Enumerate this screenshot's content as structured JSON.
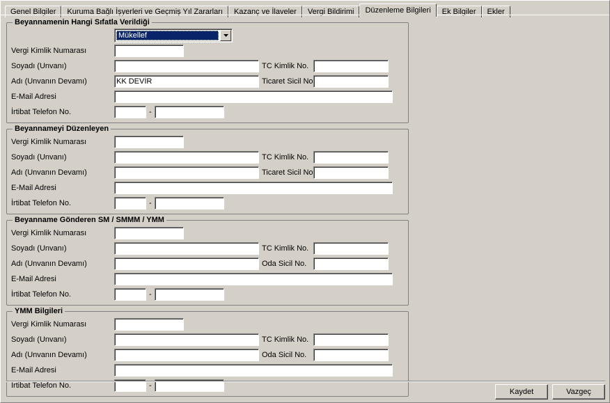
{
  "tabs": [
    {
      "label": "Genel Bilgiler"
    },
    {
      "label": "Kuruma Bağlı İşyerleri ve Geçmiş Yıl Zararları"
    },
    {
      "label": "Kazanç ve İlaveler"
    },
    {
      "label": "Vergi Bildirimi"
    },
    {
      "label": "Düzenleme Bilgileri"
    },
    {
      "label": "Ek Bilgiler"
    },
    {
      "label": "Ekler"
    }
  ],
  "active_tab": 4,
  "labels": {
    "vkn": "Vergi Kimlik Numarası",
    "soyadi": "Soyadı (Unvanı)",
    "adi": "Adı (Unvanın Devamı)",
    "email": "E-Mail Adresi",
    "telefon": "İrtibat Telefon No.",
    "tckimlik": "TC Kimlik No.",
    "ticaret": "Ticaret Sicil No.",
    "odasicil": "Oda Sicil No."
  },
  "group1": {
    "legend": "Beyannamenin Hangi Sıfatla Verildiği",
    "sifat": "Mükellef",
    "vkn": "",
    "soyadi": "",
    "adi": "KK DEVİR",
    "email": "",
    "tel1": "",
    "tel2": "",
    "tckimlik": "",
    "ticaret": ""
  },
  "group2": {
    "legend": "Beyannameyi Düzenleyen",
    "vkn": "",
    "soyadi": "",
    "adi": "",
    "email": "",
    "tel1": "",
    "tel2": "",
    "tckimlik": "",
    "ticaret": ""
  },
  "group3": {
    "legend": "Beyanname Gönderen SM / SMMM / YMM",
    "vkn": "",
    "soyadi": "",
    "adi": "",
    "email": "",
    "tel1": "",
    "tel2": "",
    "tckimlik": "",
    "odasicil": ""
  },
  "group4": {
    "legend": "YMM Bilgileri",
    "vkn": "",
    "soyadi": "",
    "adi": "",
    "email": "",
    "tel1": "",
    "tel2": "",
    "tckimlik": "",
    "odasicil": ""
  },
  "buttons": {
    "save": "Kaydet",
    "cancel": "Vazgeç"
  }
}
